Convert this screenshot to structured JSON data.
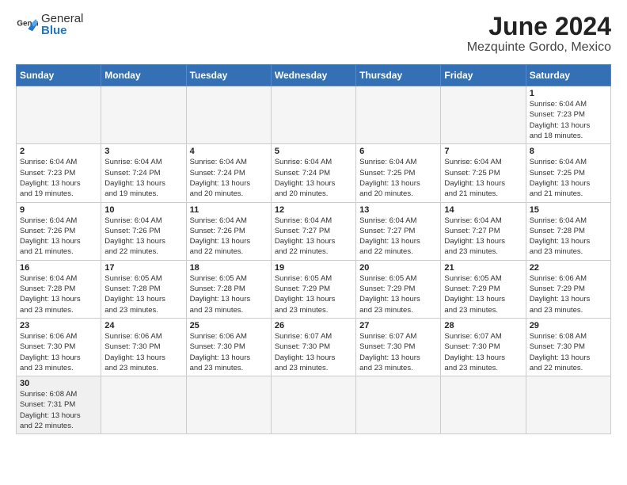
{
  "header": {
    "logo_general": "General",
    "logo_blue": "Blue",
    "title": "June 2024",
    "subtitle": "Mezquinte Gordo, Mexico"
  },
  "weekdays": [
    "Sunday",
    "Monday",
    "Tuesday",
    "Wednesday",
    "Thursday",
    "Friday",
    "Saturday"
  ],
  "weeks": [
    [
      {
        "day": "",
        "info": ""
      },
      {
        "day": "",
        "info": ""
      },
      {
        "day": "",
        "info": ""
      },
      {
        "day": "",
        "info": ""
      },
      {
        "day": "",
        "info": ""
      },
      {
        "day": "",
        "info": ""
      },
      {
        "day": "1",
        "info": "Sunrise: 6:04 AM\nSunset: 7:23 PM\nDaylight: 13 hours\nand 18 minutes."
      }
    ],
    [
      {
        "day": "2",
        "info": "Sunrise: 6:04 AM\nSunset: 7:23 PM\nDaylight: 13 hours\nand 19 minutes."
      },
      {
        "day": "3",
        "info": "Sunrise: 6:04 AM\nSunset: 7:24 PM\nDaylight: 13 hours\nand 19 minutes."
      },
      {
        "day": "4",
        "info": "Sunrise: 6:04 AM\nSunset: 7:24 PM\nDaylight: 13 hours\nand 20 minutes."
      },
      {
        "day": "5",
        "info": "Sunrise: 6:04 AM\nSunset: 7:24 PM\nDaylight: 13 hours\nand 20 minutes."
      },
      {
        "day": "6",
        "info": "Sunrise: 6:04 AM\nSunset: 7:25 PM\nDaylight: 13 hours\nand 20 minutes."
      },
      {
        "day": "7",
        "info": "Sunrise: 6:04 AM\nSunset: 7:25 PM\nDaylight: 13 hours\nand 21 minutes."
      },
      {
        "day": "8",
        "info": "Sunrise: 6:04 AM\nSunset: 7:25 PM\nDaylight: 13 hours\nand 21 minutes."
      }
    ],
    [
      {
        "day": "9",
        "info": "Sunrise: 6:04 AM\nSunset: 7:26 PM\nDaylight: 13 hours\nand 21 minutes."
      },
      {
        "day": "10",
        "info": "Sunrise: 6:04 AM\nSunset: 7:26 PM\nDaylight: 13 hours\nand 22 minutes."
      },
      {
        "day": "11",
        "info": "Sunrise: 6:04 AM\nSunset: 7:26 PM\nDaylight: 13 hours\nand 22 minutes."
      },
      {
        "day": "12",
        "info": "Sunrise: 6:04 AM\nSunset: 7:27 PM\nDaylight: 13 hours\nand 22 minutes."
      },
      {
        "day": "13",
        "info": "Sunrise: 6:04 AM\nSunset: 7:27 PM\nDaylight: 13 hours\nand 22 minutes."
      },
      {
        "day": "14",
        "info": "Sunrise: 6:04 AM\nSunset: 7:27 PM\nDaylight: 13 hours\nand 23 minutes."
      },
      {
        "day": "15",
        "info": "Sunrise: 6:04 AM\nSunset: 7:28 PM\nDaylight: 13 hours\nand 23 minutes."
      }
    ],
    [
      {
        "day": "16",
        "info": "Sunrise: 6:04 AM\nSunset: 7:28 PM\nDaylight: 13 hours\nand 23 minutes."
      },
      {
        "day": "17",
        "info": "Sunrise: 6:05 AM\nSunset: 7:28 PM\nDaylight: 13 hours\nand 23 minutes."
      },
      {
        "day": "18",
        "info": "Sunrise: 6:05 AM\nSunset: 7:28 PM\nDaylight: 13 hours\nand 23 minutes."
      },
      {
        "day": "19",
        "info": "Sunrise: 6:05 AM\nSunset: 7:29 PM\nDaylight: 13 hours\nand 23 minutes."
      },
      {
        "day": "20",
        "info": "Sunrise: 6:05 AM\nSunset: 7:29 PM\nDaylight: 13 hours\nand 23 minutes."
      },
      {
        "day": "21",
        "info": "Sunrise: 6:05 AM\nSunset: 7:29 PM\nDaylight: 13 hours\nand 23 minutes."
      },
      {
        "day": "22",
        "info": "Sunrise: 6:06 AM\nSunset: 7:29 PM\nDaylight: 13 hours\nand 23 minutes."
      }
    ],
    [
      {
        "day": "23",
        "info": "Sunrise: 6:06 AM\nSunset: 7:30 PM\nDaylight: 13 hours\nand 23 minutes."
      },
      {
        "day": "24",
        "info": "Sunrise: 6:06 AM\nSunset: 7:30 PM\nDaylight: 13 hours\nand 23 minutes."
      },
      {
        "day": "25",
        "info": "Sunrise: 6:06 AM\nSunset: 7:30 PM\nDaylight: 13 hours\nand 23 minutes."
      },
      {
        "day": "26",
        "info": "Sunrise: 6:07 AM\nSunset: 7:30 PM\nDaylight: 13 hours\nand 23 minutes."
      },
      {
        "day": "27",
        "info": "Sunrise: 6:07 AM\nSunset: 7:30 PM\nDaylight: 13 hours\nand 23 minutes."
      },
      {
        "day": "28",
        "info": "Sunrise: 6:07 AM\nSunset: 7:30 PM\nDaylight: 13 hours\nand 23 minutes."
      },
      {
        "day": "29",
        "info": "Sunrise: 6:08 AM\nSunset: 7:30 PM\nDaylight: 13 hours\nand 22 minutes."
      }
    ],
    [
      {
        "day": "30",
        "info": "Sunrise: 6:08 AM\nSunset: 7:31 PM\nDaylight: 13 hours\nand 22 minutes."
      },
      {
        "day": "",
        "info": ""
      },
      {
        "day": "",
        "info": ""
      },
      {
        "day": "",
        "info": ""
      },
      {
        "day": "",
        "info": ""
      },
      {
        "day": "",
        "info": ""
      },
      {
        "day": "",
        "info": ""
      }
    ]
  ]
}
